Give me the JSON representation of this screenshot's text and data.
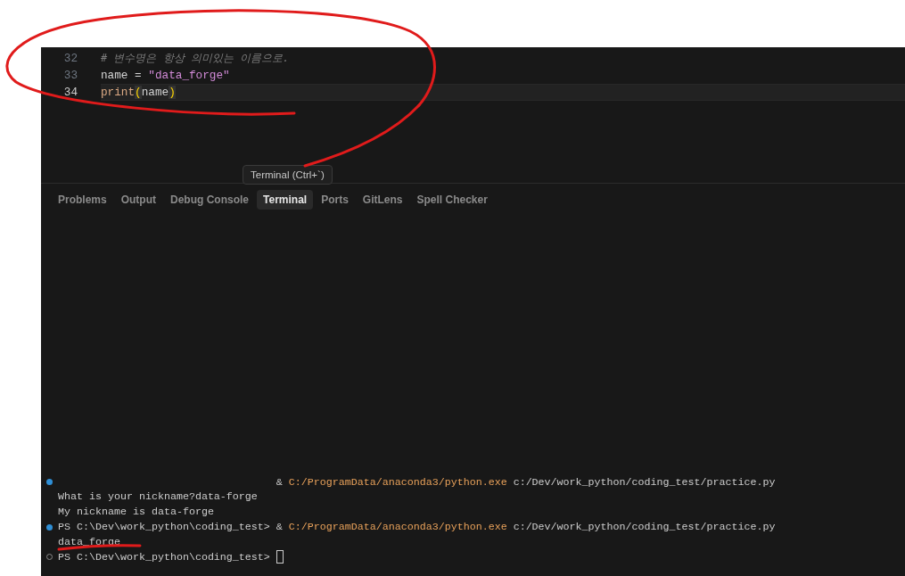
{
  "editor": {
    "lines": [
      {
        "number": "32",
        "current": false,
        "tokens": [
          {
            "text": "# 변수명은 항상 의미있는 이름으로.",
            "kind": "comment"
          }
        ]
      },
      {
        "number": "33",
        "current": false,
        "tokens": [
          {
            "text": "name",
            "kind": "plain"
          },
          {
            "text": " = ",
            "kind": "plain"
          },
          {
            "text": "\"data_forge\"",
            "kind": "string"
          }
        ]
      },
      {
        "number": "34",
        "current": true,
        "tokens": [
          {
            "text": "print",
            "kind": "function"
          },
          {
            "text": "(",
            "kind": "bracket-match"
          },
          {
            "text": "name",
            "kind": "plain"
          },
          {
            "text": ")",
            "kind": "bracket-match"
          }
        ]
      }
    ]
  },
  "tooltip": {
    "text": "Terminal (Ctrl+`)"
  },
  "panel": {
    "tabs": [
      {
        "label": "Problems",
        "selected": false
      },
      {
        "label": "Output",
        "selected": false
      },
      {
        "label": "Debug Console",
        "selected": false
      },
      {
        "label": "Terminal",
        "selected": true
      },
      {
        "label": "Ports",
        "selected": false
      },
      {
        "label": "GitLens",
        "selected": false
      },
      {
        "label": "Spell Checker",
        "selected": false
      }
    ]
  },
  "terminal": {
    "lines": [
      {
        "kind": "finished-command",
        "prompt_erased": true,
        "segments": [
          {
            "text": "& ",
            "kind": "plain"
          },
          {
            "text": "C:/ProgramData/anaconda3/python.exe",
            "kind": "executable"
          },
          {
            "text": " c:/Dev/work_python/coding_test/practice.py",
            "kind": "plain"
          }
        ]
      },
      {
        "kind": "output",
        "segments": [
          {
            "text": "What is your nickname?data-forge",
            "kind": "plain"
          }
        ]
      },
      {
        "kind": "output",
        "segments": [
          {
            "text": "My nickname is data-forge",
            "kind": "plain"
          }
        ]
      },
      {
        "kind": "finished-command",
        "segments": [
          {
            "text": "PS C:\\Dev\\work_python\\coding_test> & ",
            "kind": "plain"
          },
          {
            "text": "C:/ProgramData/anaconda3/python.exe",
            "kind": "executable"
          },
          {
            "text": " c:/Dev/work_python/coding_test/practice.py",
            "kind": "plain"
          }
        ]
      },
      {
        "kind": "output",
        "segments": [
          {
            "text": "data_forge",
            "kind": "plain"
          }
        ]
      },
      {
        "kind": "pending-prompt",
        "cursor": true,
        "segments": [
          {
            "text": "PS C:\\Dev\\work_python\\coding_test> ",
            "kind": "plain"
          }
        ]
      }
    ]
  }
}
